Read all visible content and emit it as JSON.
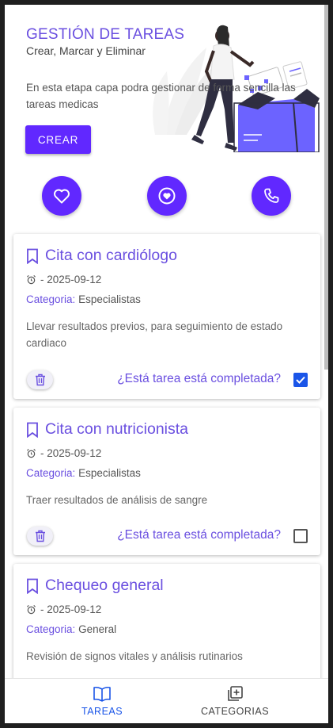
{
  "hero": {
    "title": "GESTIÓN DE TAREAS",
    "subtitle": "Crear, Marcar y Eliminar",
    "description": "En esta etapa capa podra gestionar de forma sencilla las tareas medicas",
    "create_label": "CREAR"
  },
  "quick_actions": [
    {
      "icon": "heart-icon"
    },
    {
      "icon": "heart-circle-icon"
    },
    {
      "icon": "phone-icon"
    }
  ],
  "tasks": [
    {
      "title": "Cita con cardiólogo",
      "date": "- 2025-09-12",
      "category_label": "Categoria:",
      "category": "Especialistas",
      "description": "Llevar resultados previos, para seguimiento de estado cardiaco",
      "complete_question": "¿Está tarea está completada?",
      "completed": true
    },
    {
      "title": "Cita con nutricionista",
      "date": "- 2025-09-12",
      "category_label": "Categoria:",
      "category": "Especialistas",
      "description": "Traer resultados de análisis de sangre",
      "complete_question": "¿Está tarea está completada?",
      "completed": false
    },
    {
      "title": "Chequeo general",
      "date": "- 2025-09-12",
      "category_label": "Categoria:",
      "category": "General",
      "description": "Revisión de signos vitales y análisis rutinarios",
      "complete_question": "¿Está tarea está completada?",
      "completed": false
    }
  ],
  "bottom_nav": {
    "tareas_label": "TAREAS",
    "categorias_label": "CATEGORIAS",
    "active": "tareas"
  },
  "colors": {
    "accent": "#6128ff",
    "title": "#6a4fe0",
    "checkbox_checked": "#1a55e8",
    "nav_active": "#1a55e8"
  }
}
